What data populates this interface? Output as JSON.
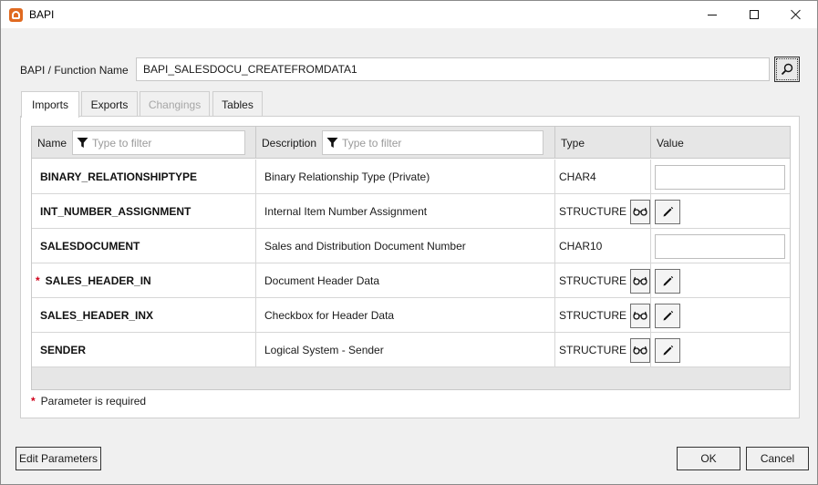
{
  "window": {
    "title": "BAPI",
    "app_icon": "app-logo-icon",
    "controls": [
      "minimize-icon",
      "maximize-icon",
      "close-icon"
    ]
  },
  "function": {
    "label": "BAPI / Function Name",
    "value": "BAPI_SALESDOCU_CREATEFROMDATA1",
    "search_icon": "search-icon"
  },
  "tabs": [
    {
      "label": "Imports",
      "active": true,
      "enabled": true
    },
    {
      "label": "Exports",
      "active": false,
      "enabled": true
    },
    {
      "label": "Changings",
      "active": false,
      "enabled": false
    },
    {
      "label": "Tables",
      "active": false,
      "enabled": true
    }
  ],
  "grid": {
    "columns": {
      "name": {
        "label": "Name",
        "filter_placeholder": "Type to filter"
      },
      "description": {
        "label": "Description",
        "filter_placeholder": "Type to filter"
      },
      "type": {
        "label": "Type"
      },
      "value": {
        "label": "Value"
      }
    },
    "rows": [
      {
        "name": "BINARY_RELATIONSHIPTYPE",
        "required": false,
        "description": "Binary Relationship Type (Private)",
        "type": "CHAR4",
        "value_kind": "input",
        "value": ""
      },
      {
        "name": "INT_NUMBER_ASSIGNMENT",
        "required": false,
        "description": "Internal Item Number Assignment",
        "type": "STRUCTURE",
        "value_kind": "edit",
        "value": ""
      },
      {
        "name": "SALESDOCUMENT",
        "required": false,
        "description": "Sales and Distribution Document Number",
        "type": "CHAR10",
        "value_kind": "input",
        "value": ""
      },
      {
        "name": "SALES_HEADER_IN",
        "required": true,
        "description": "Document Header Data",
        "type": "STRUCTURE",
        "value_kind": "edit",
        "value": ""
      },
      {
        "name": "SALES_HEADER_INX",
        "required": false,
        "description": "Checkbox for Header Data",
        "type": "STRUCTURE",
        "value_kind": "edit",
        "value": ""
      },
      {
        "name": "SENDER",
        "required": false,
        "description": "Logical System - Sender",
        "type": "STRUCTURE",
        "value_kind": "edit",
        "value": ""
      }
    ]
  },
  "required_note": {
    "star": "*",
    "text": "Parameter is required"
  },
  "buttons": {
    "edit_parameters": "Edit Parameters",
    "ok": "OK",
    "cancel": "Cancel"
  },
  "colors": {
    "required_star": "#d0021b",
    "app_icon": "#e06a20",
    "header_bg": "#e6e6e6"
  }
}
